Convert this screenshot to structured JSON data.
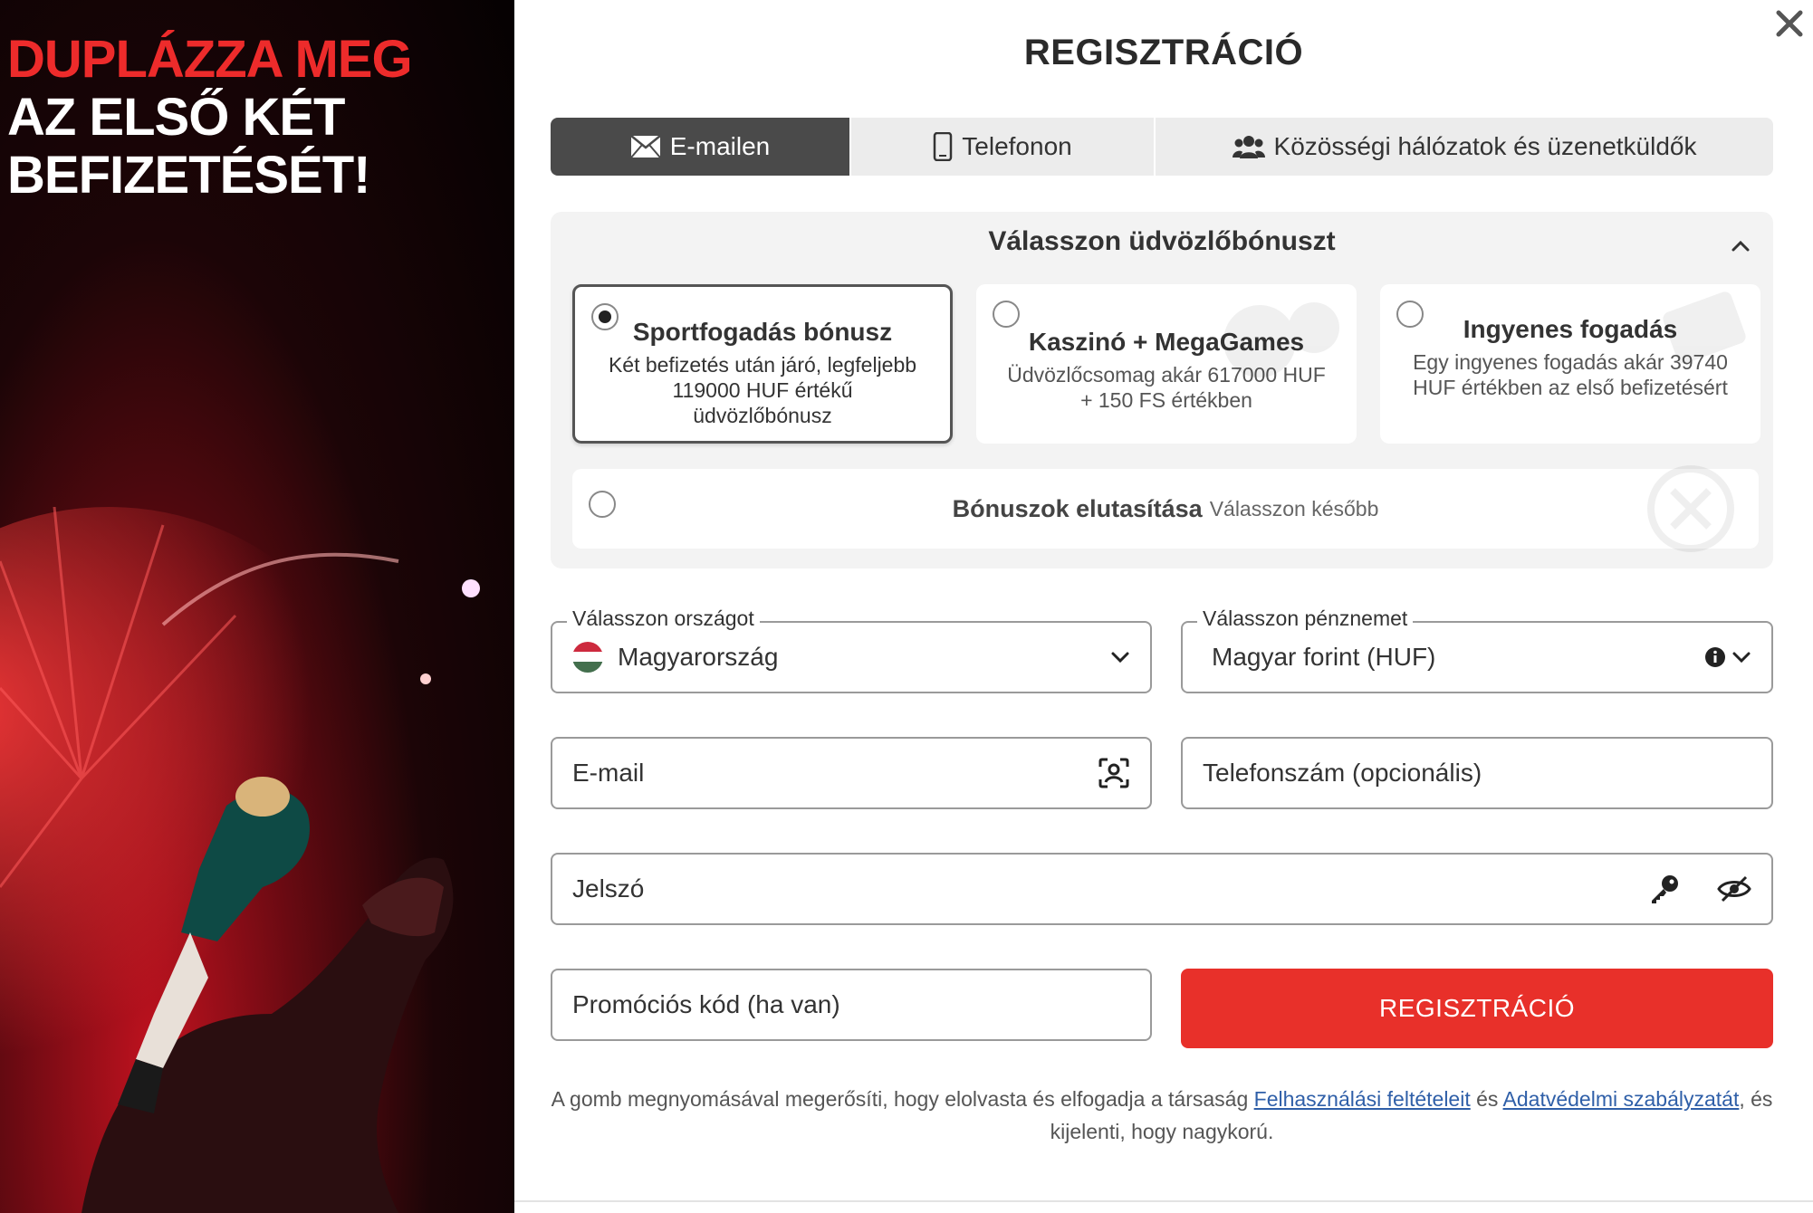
{
  "promo": {
    "line1": "DUPLÁZZA MEG",
    "line2": "AZ ELSŐ KÉT",
    "line3": "BEFIZETÉSÉT!"
  },
  "modal": {
    "title": "REGISZTRÁCIÓ",
    "close_icon": "close-icon"
  },
  "tabs": [
    {
      "label": "E-mailen",
      "icon": "envelope-icon",
      "active": true
    },
    {
      "label": "Telefonon",
      "icon": "mobile-phone-icon",
      "active": false
    },
    {
      "label": "Közösségi hálózatok és üzenetküldők",
      "icon": "users-icon",
      "active": false
    }
  ],
  "bonus": {
    "heading": "Válasszon üdvözlőbónuszt",
    "options": [
      {
        "title": "Sportfogadás bónusz",
        "desc": "Két befizetés után járó, legfeljebb 119000 HUF értékű üdvözlőbónusz",
        "selected": true
      },
      {
        "title": "Kaszinó + MegaGames",
        "desc": "Üdvözlőcsomag akár 617000 HUF + 150 FS értékben",
        "selected": false
      },
      {
        "title": "Ingyenes fogadás",
        "desc": "Egy ingyenes fogadás akár 39740 HUF értékben az első befizetésért",
        "selected": false
      }
    ],
    "decline_title": "Bónuszok elutasítása",
    "decline_sub": "Válasszon később"
  },
  "form": {
    "country_legend": "Válasszon országot",
    "country_value": "Magyarország",
    "currency_legend": "Válasszon pénznemet",
    "currency_value": "Magyar forint (HUF)",
    "email_placeholder": "E-mail",
    "phone_placeholder": "Telefonszám (opcionális)",
    "password_placeholder": "Jelszó",
    "promo_placeholder": "Promóciós kód (ha van)",
    "submit_label": "REGISZTRÁCIÓ"
  },
  "legal": {
    "text1": "A gomb megnyomásával megerősíti, hogy elolvasta és elfogadja a társaság ",
    "link1": "Felhasználási feltételeit",
    "text2": " és ",
    "link2": "Adatvédelmi szabályzatát",
    "text3": ", és kijelenti, hogy nagykorú."
  },
  "colors": {
    "accent_red": "#e8302a",
    "promo_red": "#ed2b2b",
    "tab_active_bg": "#4a4a4a",
    "link_blue": "#2f5fa8"
  }
}
